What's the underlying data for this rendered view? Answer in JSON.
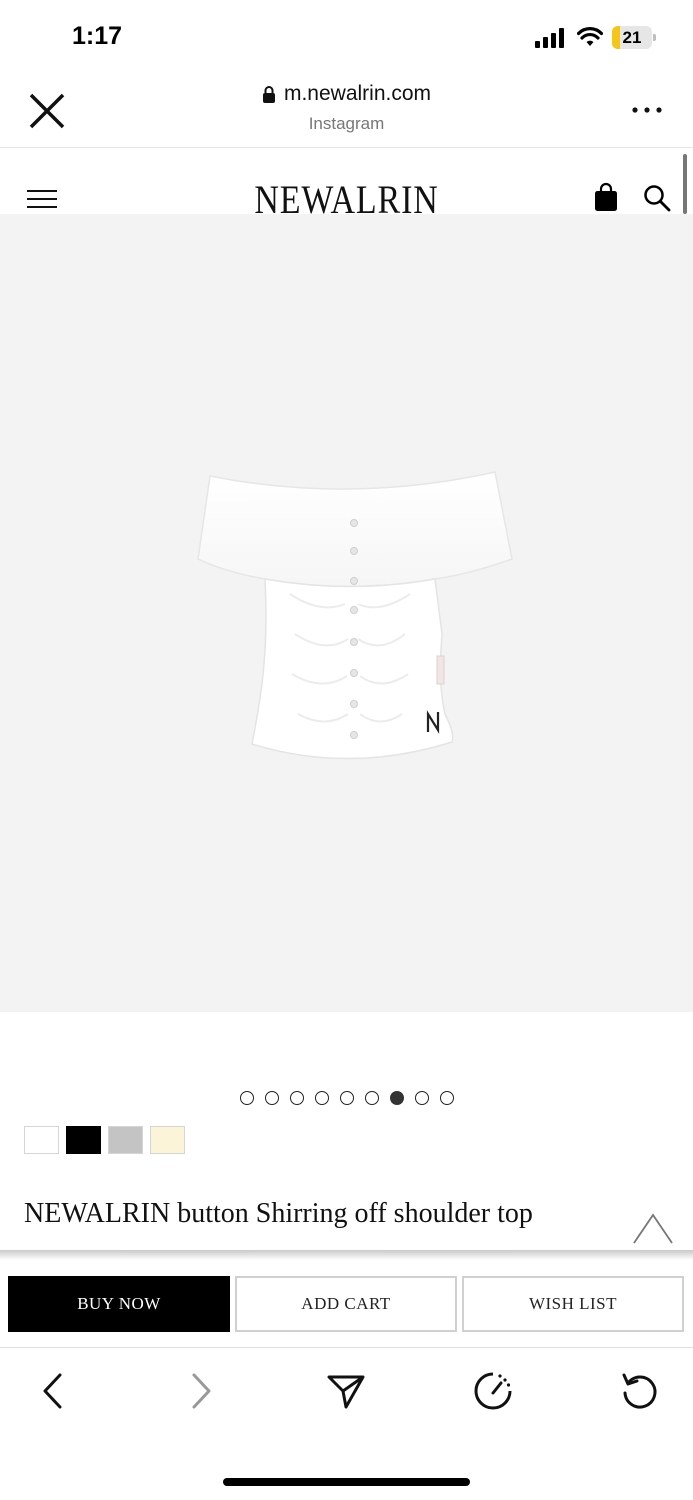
{
  "status_bar": {
    "time": "1:17",
    "battery_level": "21",
    "battery_fraction": 0.21,
    "battery_color": "#f5c518"
  },
  "browser": {
    "url": "m.newalrin.com",
    "source": "Instagram",
    "close_icon": "close-icon",
    "more_icon": "more-icon",
    "lock_icon": "lock-icon"
  },
  "site": {
    "brand": "NEWALRIN",
    "menu_icon": "hamburger-menu-icon",
    "bag_icon": "shopping-bag-icon",
    "search_icon": "search-icon"
  },
  "product": {
    "title": "NEWALRIN button Shirring off shoulder top",
    "image_background": "#f3f3f3",
    "carousel": {
      "total": 9,
      "active_index": 6
    },
    "swatches": [
      {
        "name": "white",
        "color": "#ffffff"
      },
      {
        "name": "black",
        "color": "#000000"
      },
      {
        "name": "gray",
        "color": "#c4c4c4"
      },
      {
        "name": "cream",
        "color": "#fcf4d9"
      }
    ]
  },
  "actions": {
    "buy_now": "BUY NOW",
    "add_cart": "ADD CART",
    "wish_list": "WISH LIST"
  },
  "bottom_nav": {
    "back_icon": "back-arrow-icon",
    "forward_icon": "forward-arrow-icon",
    "share_icon": "share-icon",
    "speed_icon": "speed-icon",
    "reload_icon": "reload-icon"
  }
}
